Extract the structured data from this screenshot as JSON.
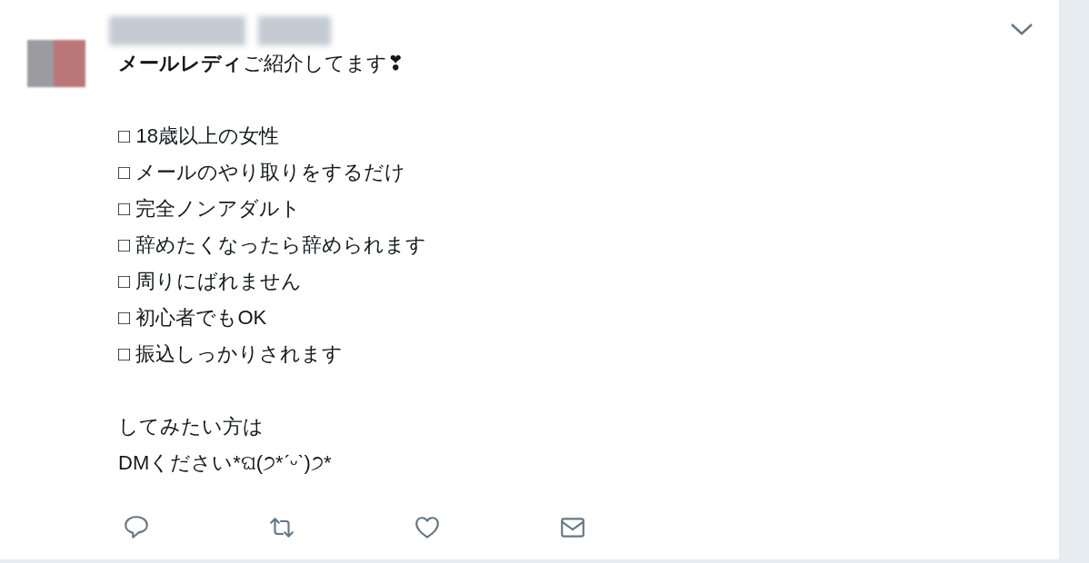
{
  "tweet": {
    "headline": "**メールレディ**ご紹介してます❣",
    "checklist": [
      "□ 18歳以上の女性",
      "□ メールのやり取りをするだけ",
      "□ 完全ノンアダルト",
      "□ 辞めたくなったら辞められます",
      "□ 周りにばれません",
      "□ 初心者でもOK",
      "□ 振込しっかりされます"
    ],
    "closing": [
      "してみたい方は",
      "DMください*ଘ(੭*ˊᵕˋ)੭*"
    ],
    "actions": [
      {
        "kind": "reply"
      },
      {
        "kind": "retweet"
      },
      {
        "kind": "like"
      },
      {
        "kind": "message"
      }
    ]
  }
}
